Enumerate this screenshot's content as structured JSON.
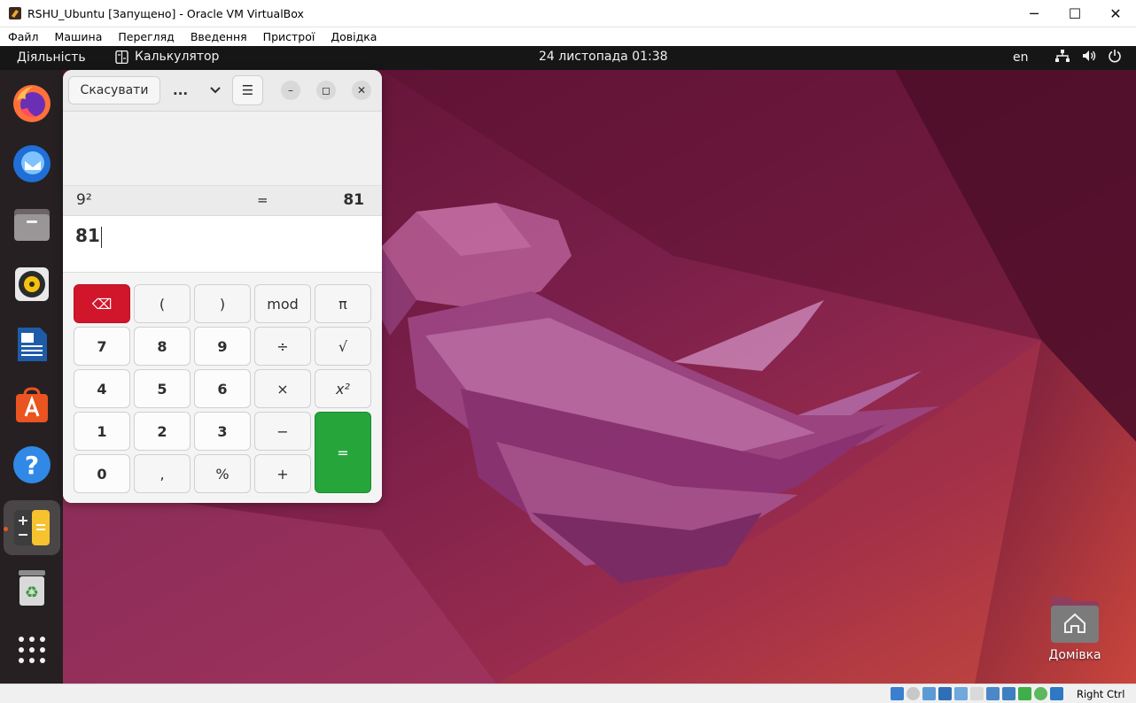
{
  "host": {
    "title": "RSHU_Ubuntu [Запущено] - Oracle VM VirtualBox",
    "menu": [
      "Файл",
      "Машина",
      "Перегляд",
      "Введення",
      "Пристрої",
      "Довідка"
    ],
    "window_buttons": {
      "minimize": "─",
      "maximize": "☐",
      "close": "✕"
    },
    "host_key": "Right Ctrl"
  },
  "topbar": {
    "activities": "Діяльність",
    "app_name": "Калькулятор",
    "clock": "24 листопада  01:38",
    "lang": "en"
  },
  "dock": {
    "apps": [
      "firefox-icon",
      "thunderbird-icon",
      "files-icon",
      "rhythmbox-icon",
      "writer-icon",
      "app-center-icon",
      "help-icon",
      "calculator-icon",
      "trash-icon",
      "show-apps-icon"
    ]
  },
  "desktop": {
    "home_label": "Домівка"
  },
  "calculator": {
    "cancel_label": "Скасувати",
    "mode_label": "...",
    "menu_glyph": "☰",
    "minimize_glyph": "–",
    "maximize_glyph": "◻",
    "close_glyph": "✕",
    "history": {
      "expression": "9²",
      "equals": "=",
      "result": "81"
    },
    "entry": "81",
    "keys": {
      "backspace": "⌫",
      "lparen": "(",
      "rparen": ")",
      "mod": "mod",
      "pi": "π",
      "k7": "7",
      "k8": "8",
      "k9": "9",
      "divide": "÷",
      "sqrt": "√",
      "k4": "4",
      "k5": "5",
      "k6": "6",
      "multiply": "×",
      "square": "x²",
      "k1": "1",
      "k2": "2",
      "k3": "3",
      "minus": "−",
      "equals": "=",
      "k0": "0",
      "comma": ",",
      "percent": "%",
      "plus": "+"
    }
  },
  "colors": {
    "delete_key": "#d1162c",
    "equals_key": "#26a53a",
    "topbar": "#161616",
    "dock": "#262023"
  }
}
